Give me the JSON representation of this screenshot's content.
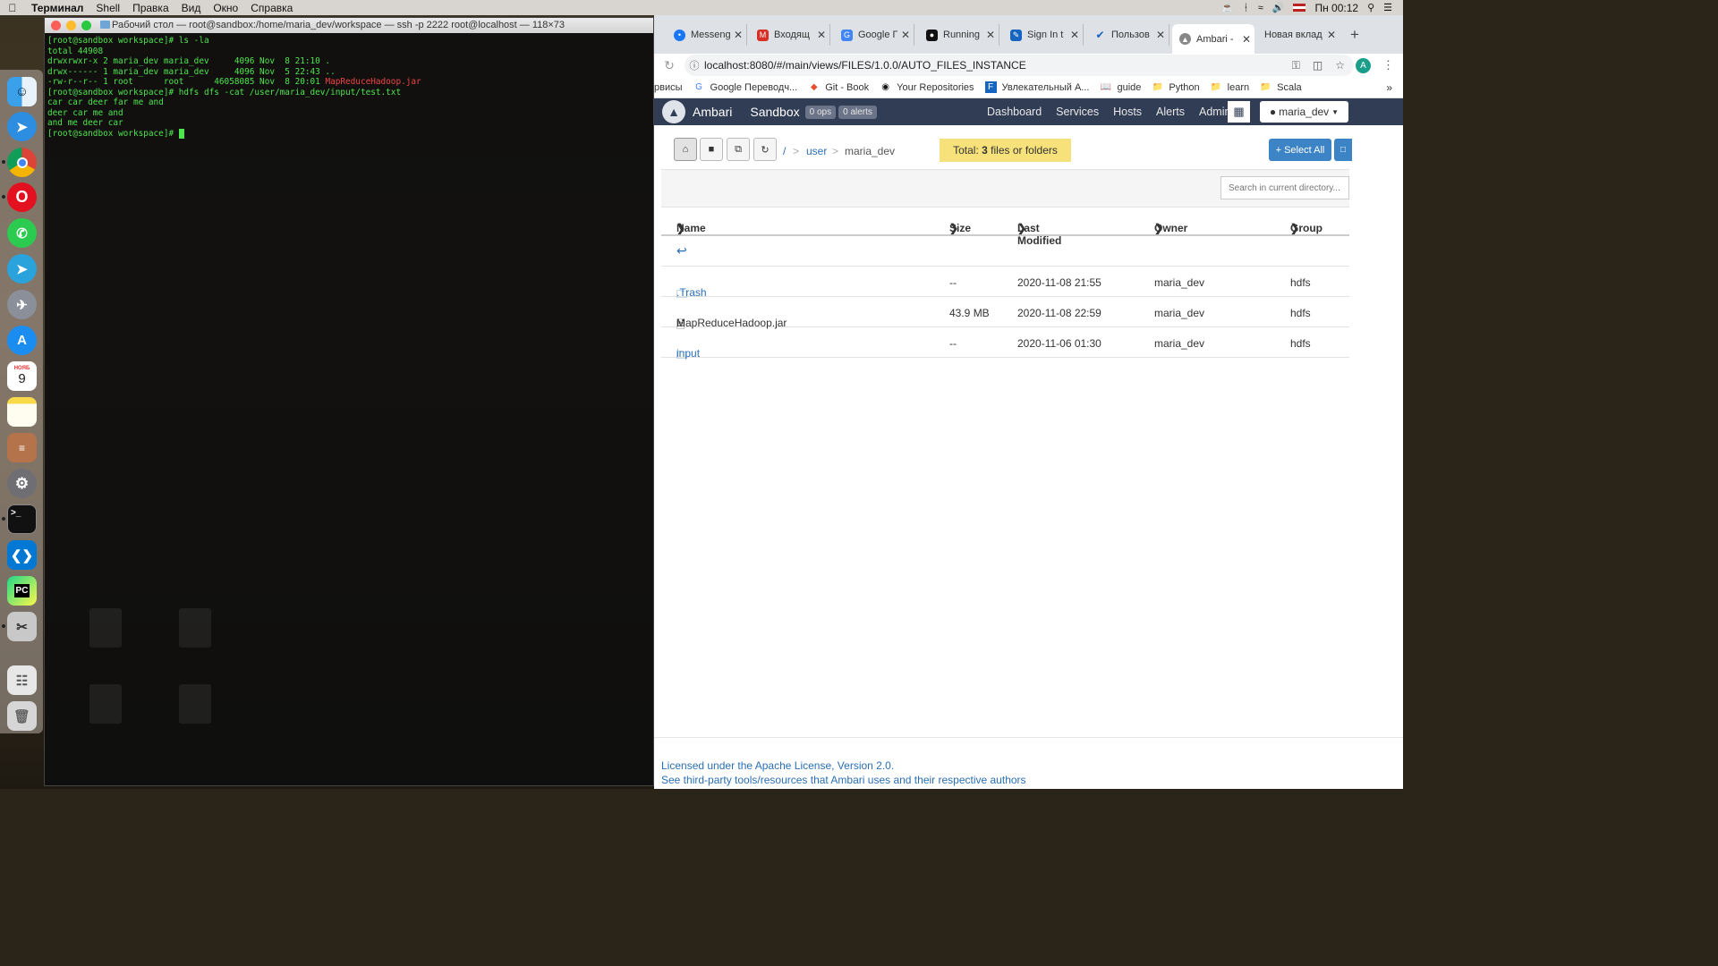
{
  "menubar": {
    "app": "Терминал",
    "items": [
      "Shell",
      "Правка",
      "Вид",
      "Окно",
      "Справка"
    ],
    "clock": "Пн 00:12"
  },
  "terminal": {
    "title": "Рабочий стол — root@sandbox:/home/maria_dev/workspace — ssh -p 2222 root@localhost — 118×73",
    "lines": [
      "[root@sandbox workspace]# ls -la",
      "total 44908",
      "drwxrwxr-x 2 maria_dev maria_dev     4096 Nov  8 21:10 .",
      "drwx------ 1 maria_dev maria_dev     4096 Nov  5 22:43 ..",
      "-rw-r--r-- 1 root      root      46058085 Nov  8 20:01 ",
      "[root@sandbox workspace]# hdfs dfs -cat /user/maria_dev/input/test.txt",
      "car car deer far me and",
      "deer car me and",
      "and me deer car",
      "[root@sandbox workspace]# "
    ],
    "jar_name": "MapReduceHadoop.jar"
  },
  "dock": {
    "calendar_day": "9",
    "calendar_month": "НОЯБ"
  },
  "browser": {
    "tabs": [
      {
        "label": "Messeng",
        "icon": "messenger-icon",
        "color": "#1877f2"
      },
      {
        "label": "Входящ",
        "icon": "gmail-icon",
        "color": "#d93025"
      },
      {
        "label": "Google П",
        "icon": "google-translate-icon",
        "color": "#4285f4"
      },
      {
        "label": "Running",
        "icon": "medium-icon",
        "color": "#111111"
      },
      {
        "label": "Sign In t",
        "icon": "sign-in-icon",
        "color": "#1565c0"
      },
      {
        "label": "Пользов",
        "icon": "check-icon",
        "color": "#1565c0"
      },
      {
        "label": "Ambari -",
        "icon": "ambari-icon",
        "color": "#555555"
      },
      {
        "label": "Новая вклад",
        "icon": "",
        "color": ""
      }
    ],
    "url": "localhost:8080/#/main/views/FILES/1.0.0/AUTO_FILES_INSTANCE",
    "profile_initial": "A",
    "bookmarks": [
      {
        "label": "рвисы",
        "icon": ""
      },
      {
        "label": "Google Переводч...",
        "icon": "translate-icon"
      },
      {
        "label": "Git - Book",
        "icon": "git-icon"
      },
      {
        "label": "Your Repositories",
        "icon": "github-icon"
      },
      {
        "label": "Увлекательный А...",
        "icon": "bookmark-icon"
      },
      {
        "label": "guide",
        "icon": "book-icon"
      },
      {
        "label": "Python",
        "icon": "folder-icon"
      },
      {
        "label": "learn",
        "icon": "folder-icon"
      },
      {
        "label": "Scala",
        "icon": "folder-icon"
      }
    ]
  },
  "ambari": {
    "brand": "Ambari",
    "cluster": "Sandbox",
    "ops_badge": "0 ops",
    "alerts_badge": "0 alerts",
    "nav": [
      "Dashboard",
      "Services",
      "Hosts",
      "Alerts",
      "Admin"
    ],
    "user": "maria_dev",
    "breadcrumb": {
      "root": "/",
      "sep": ">",
      "user": "user",
      "current": "maria_dev"
    },
    "total": {
      "prefix": "Total: ",
      "count": "3",
      "suffix": " files or folders"
    },
    "select_all": "Select All",
    "search_placeholder": "Search in current directory...",
    "columns": [
      "Name",
      "Size",
      "Last Modified",
      "Owner",
      "Group"
    ],
    "files": [
      {
        "name": ".Trash",
        "type": "folder",
        "size": "--",
        "modified": "2020-11-08 21:55",
        "owner": "maria_dev",
        "group": "hdfs"
      },
      {
        "name": "MapReduceHadoop.jar",
        "type": "file",
        "size": "43.9 MB",
        "modified": "2020-11-08 22:59",
        "owner": "maria_dev",
        "group": "hdfs"
      },
      {
        "name": "input",
        "type": "folder",
        "size": "--",
        "modified": "2020-11-06 01:30",
        "owner": "maria_dev",
        "group": "hdfs"
      }
    ],
    "footer": [
      "Licensed under the Apache License, Version 2.0.",
      "See third-party tools/resources that Ambari uses and their respective authors"
    ]
  }
}
